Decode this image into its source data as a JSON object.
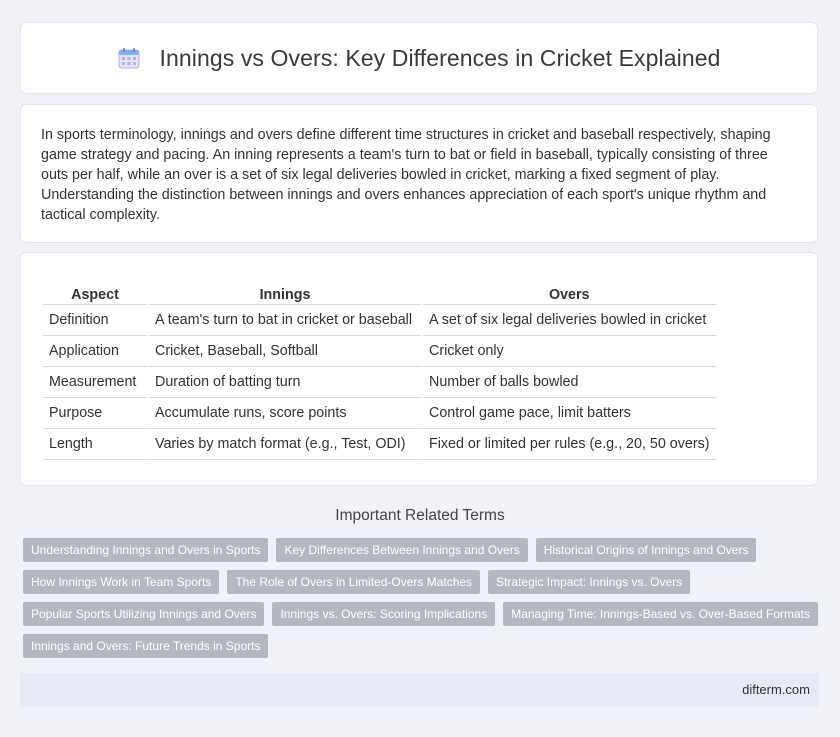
{
  "header": {
    "title": "Innings vs Overs: Key Differences in Cricket Explained",
    "icon": "calendar-icon"
  },
  "intro": {
    "text": "In sports terminology, innings and overs define different time structures in cricket and baseball respectively, shaping game strategy and pacing. An inning represents a team's turn to bat or field in baseball, typically consisting of three outs per half, while an over is a set of six legal deliveries bowled in cricket, marking a fixed segment of play. Understanding the distinction between innings and overs enhances appreciation of each sport's unique rhythm and tactical complexity."
  },
  "table": {
    "headers": [
      "Aspect",
      "Innings",
      "Overs"
    ],
    "rows": [
      [
        "Definition",
        "A team's turn to bat in cricket or baseball",
        "A set of six legal deliveries bowled in cricket"
      ],
      [
        "Application",
        "Cricket, Baseball, Softball",
        "Cricket only"
      ],
      [
        "Measurement",
        "Duration of batting turn",
        "Number of balls bowled"
      ],
      [
        "Purpose",
        "Accumulate runs, score points",
        "Control game pace, limit batters"
      ],
      [
        "Length",
        "Varies by match format (e.g., Test, ODI)",
        "Fixed or limited per rules (e.g., 20, 50 overs)"
      ]
    ]
  },
  "related": {
    "title": "Important Related Terms",
    "rows": [
      [
        "Understanding Innings and Overs in Sports",
        "Key Differences Between Innings and Overs",
        "Historical Origins of Innings and Overs"
      ],
      [
        "How Innings Work in Team Sports",
        "The Role of Overs in Limited-Overs Matches",
        "Strategic Impact: Innings vs. Overs"
      ],
      [
        "Popular Sports Utilizing Innings and Overs",
        "Innings vs. Overs: Scoring Implications",
        "Managing Time: Innings-Based vs. Over-Based Formats"
      ],
      [
        "Innings and Overs: Future Trends in Sports"
      ]
    ]
  },
  "footer": {
    "brand": "difterm.com"
  },
  "colors": {
    "tag_bg": "#b4b8c0",
    "footer_bg": "#e6eaf4",
    "page_bg": "#f0f2f7"
  }
}
